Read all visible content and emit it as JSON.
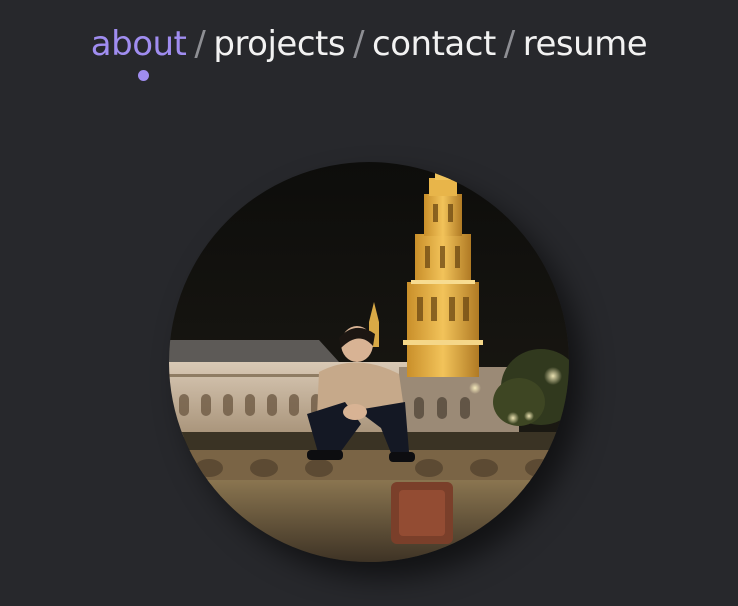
{
  "nav": {
    "items": [
      {
        "label": "about",
        "active": true
      },
      {
        "label": "projects",
        "active": false
      },
      {
        "label": "contact",
        "active": false
      },
      {
        "label": "resume",
        "active": false
      }
    ],
    "separator": "/"
  },
  "colors": {
    "background": "#27282c",
    "accent": "#a08df0",
    "nav_text": "#f2f2f2"
  }
}
